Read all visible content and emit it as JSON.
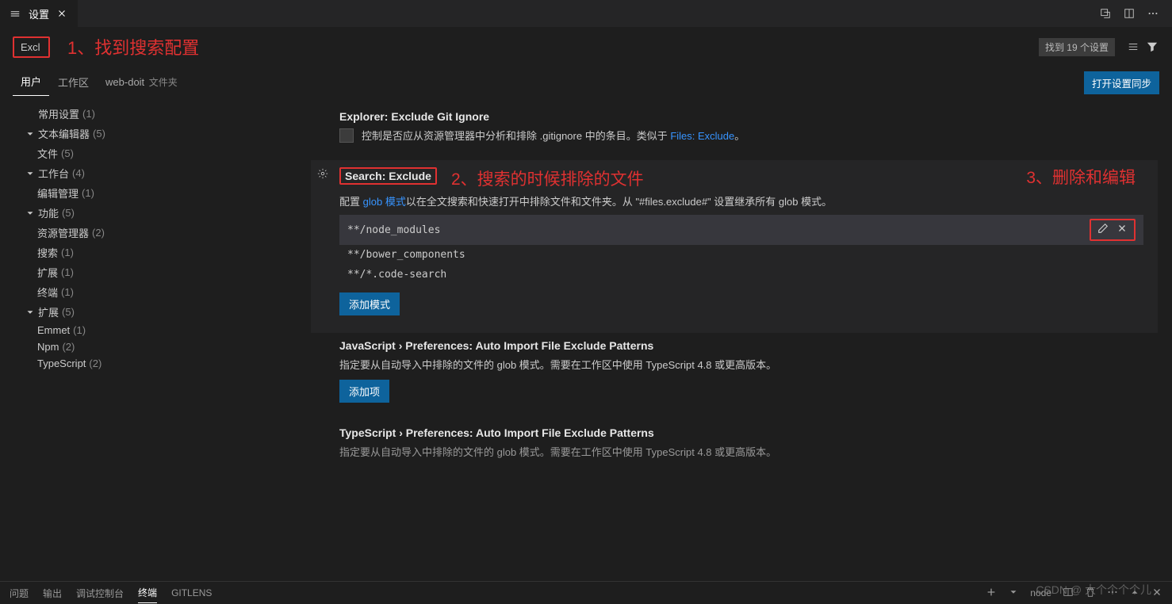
{
  "tab": {
    "title": "设置"
  },
  "annotations": {
    "one": "1、找到搜索配置",
    "two": "2、搜索的时候排除的文件",
    "three": "3、删除和编辑"
  },
  "search": {
    "value": "Excl"
  },
  "results": {
    "label": "找到 19 个设置"
  },
  "scopes": {
    "user": "用户",
    "workspace": "工作区",
    "folder": "web-doit",
    "folder_suffix": "文件夹"
  },
  "sync_button": "打开设置同步",
  "tree": {
    "common": {
      "label": "常用设置",
      "count": "(1)"
    },
    "textEditor": {
      "label": "文本编辑器",
      "count": "(5)"
    },
    "files": {
      "label": "文件",
      "count": "(5)"
    },
    "workbench": {
      "label": "工作台",
      "count": "(4)"
    },
    "editorMgmt": {
      "label": "编辑管理",
      "count": "(1)"
    },
    "features": {
      "label": "功能",
      "count": "(5)"
    },
    "explorer": {
      "label": "资源管理器",
      "count": "(2)"
    },
    "searchFeat": {
      "label": "搜索",
      "count": "(1)"
    },
    "extFeat": {
      "label": "扩展",
      "count": "(1)"
    },
    "terminal": {
      "label": "终端",
      "count": "(1)"
    },
    "extensions": {
      "label": "扩展",
      "count": "(5)"
    },
    "emmet": {
      "label": "Emmet",
      "count": "(1)"
    },
    "npm": {
      "label": "Npm",
      "count": "(2)"
    },
    "typescript": {
      "label": "TypeScript",
      "count": "(2)"
    }
  },
  "settings": {
    "explorerExclude": {
      "prefix": "Explorer: ",
      "name": "Exclude Git Ignore",
      "desc_pre": "控制是否应从资源管理器中分析和排除 .gitignore 中的条目。类似于 ",
      "desc_link": "Files: Exclude",
      "desc_post": "。"
    },
    "searchExclude": {
      "prefix": "Search: ",
      "name": "Exclude",
      "desc_pre": "配置 ",
      "desc_link": "glob 模式",
      "desc_post": "以在全文搜索和快速打开中排除文件和文件夹。从 \"#files.exclude#\" 设置继承所有 glob 模式。",
      "items": [
        "**/node_modules",
        "**/bower_components",
        "**/*.code-search"
      ],
      "add_btn": "添加模式"
    },
    "jsAutoImport": {
      "prefix": "JavaScript › Preferences: ",
      "name": "Auto Import File Exclude Patterns",
      "desc": "指定要从自动导入中排除的文件的 glob 模式。需要在工作区中使用 TypeScript 4.8 或更高版本。",
      "add_btn": "添加项"
    },
    "tsAutoImport": {
      "prefix": "TypeScript › Preferences: ",
      "name": "Auto Import File Exclude Patterns",
      "desc": "指定要从自动导入中排除的文件的 glob 模式。需要在工作区中使用 TypeScript 4.8 或更高版本。"
    }
  },
  "panel": {
    "problems": "问题",
    "output": "输出",
    "debug": "调试控制台",
    "terminal": "终端",
    "gitlens": "GITLENS",
    "node_label": "node"
  },
  "watermark": "CSDN @ 大个个个个儿"
}
